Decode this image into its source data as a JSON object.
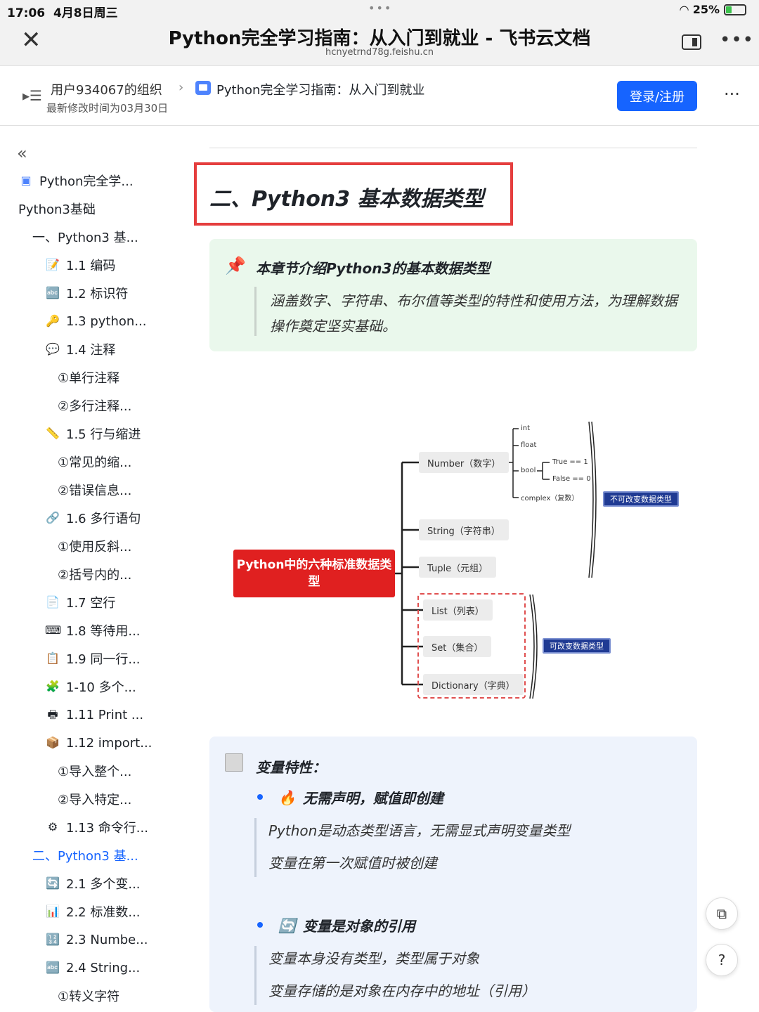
{
  "status_bar": {
    "time": "17:06",
    "date": "4月8日周三",
    "battery": "25%"
  },
  "browser": {
    "title": "Python完全学习指南：从入门到就业 - 飞书云文档",
    "url": "hcnyetrnd78g.feishu.cn"
  },
  "doc_header": {
    "org": "用户934067的组织",
    "doc_name": "Python完全学习指南：从入门到就业",
    "modified": "最新修改时间为03月30日",
    "login_label": "登录/注册"
  },
  "sidebar": {
    "items": [
      {
        "label": "Python完全学...",
        "icon": "doc-icon",
        "level": 0
      },
      {
        "label": "Python3基础",
        "icon": "",
        "level": 0
      },
      {
        "label": "一、Python3 基...",
        "icon": "",
        "level": 1
      },
      {
        "label": "1.1 编码",
        "icon": "memo-icon",
        "level": 2
      },
      {
        "label": "1.2 标识符",
        "icon": "abc-icon",
        "level": 2
      },
      {
        "label": "1.3 python...",
        "icon": "key-icon",
        "level": 2
      },
      {
        "label": "1.4 注释",
        "icon": "speech-bubble-icon",
        "level": 2
      },
      {
        "label": "①单行注释",
        "icon": "",
        "level": 3
      },
      {
        "label": "②多行注释...",
        "icon": "",
        "level": 3
      },
      {
        "label": "1.5 行与缩进",
        "icon": "ruler-icon",
        "level": 2
      },
      {
        "label": "①常见的缩...",
        "icon": "",
        "level": 3
      },
      {
        "label": "②错误信息...",
        "icon": "",
        "level": 3
      },
      {
        "label": "1.6 多行语句",
        "icon": "link-icon",
        "level": 2
      },
      {
        "label": "①使用反斜...",
        "icon": "",
        "level": 3
      },
      {
        "label": "②括号内的...",
        "icon": "",
        "level": 3
      },
      {
        "label": "1.7 空行",
        "icon": "page-icon",
        "level": 2
      },
      {
        "label": "1.8 等待用...",
        "icon": "keyboard-icon",
        "level": 2
      },
      {
        "label": "1.9 同一行...",
        "icon": "clipboard-icon",
        "level": 2
      },
      {
        "label": "1-10 多个...",
        "icon": "puzzle-icon",
        "level": 2
      },
      {
        "label": "1.11 Print ...",
        "icon": "printer-icon",
        "level": 2
      },
      {
        "label": "1.12 import...",
        "icon": "package-icon",
        "level": 2
      },
      {
        "label": "①导入整个...",
        "icon": "",
        "level": 3
      },
      {
        "label": "②导入特定...",
        "icon": "",
        "level": 3
      },
      {
        "label": "1.13 命令行...",
        "icon": "gear-icon",
        "level": 2
      },
      {
        "label": "二、Python3 基...",
        "icon": "",
        "level": 1,
        "active": true
      },
      {
        "label": "2.1 多个变...",
        "icon": "repeat-icon",
        "level": 2
      },
      {
        "label": "2.2 标准数...",
        "icon": "bar-chart-icon",
        "level": 2
      },
      {
        "label": "2.3 Numbe...",
        "icon": "numbers-icon",
        "level": 2
      },
      {
        "label": "2.4 String...",
        "icon": "abc-icon",
        "level": 2
      },
      {
        "label": "①转义字符",
        "icon": "",
        "level": 3
      }
    ]
  },
  "content": {
    "heading": "二、Python3 基本数据类型",
    "callout": {
      "title": "本章节介绍Python3的基本数据类型",
      "body": "涵盖数字、字符串、布尔值等类型的特性和使用方法，为理解数据操作奠定坚实基础。"
    },
    "mindmap": {
      "root": "Python中的六种标准数据类型",
      "nodes": {
        "number": "Number（数字）",
        "string": "String（字符串）",
        "tuple": "Tuple（元组）",
        "list": "List（列表）",
        "set": "Set（集合）",
        "dict": "Dictionary（字典）"
      },
      "leaves": {
        "int": "int",
        "float": "float",
        "bool": "bool",
        "true": "True == 1",
        "false": "False == 0",
        "complex": "complex（复数）"
      },
      "tags": {
        "immutable": "不可改变数据类型",
        "mutable": "可改变数据类型"
      }
    },
    "variables": {
      "title": "变量特性：",
      "points": [
        {
          "title": "无需声明，赋值即创建",
          "icon": "fire-icon",
          "lines": [
            "Python是动态类型语言，无需显式声明变量类型",
            "变量在第一次赋值时被创建"
          ]
        },
        {
          "title": "变量是对象的引用",
          "icon": "repeat-icon",
          "lines": [
            "变量本身没有类型，类型属于对象",
            "变量存储的是对象在内存中的地址（引用）"
          ]
        }
      ]
    }
  },
  "colors": {
    "accent": "#1664ff",
    "heading_border": "#e53e3e",
    "root_node": "#e02020",
    "tag": "#1f3a93",
    "callout_bg": "#eaf8ec",
    "var_bg": "#eef3fc"
  }
}
